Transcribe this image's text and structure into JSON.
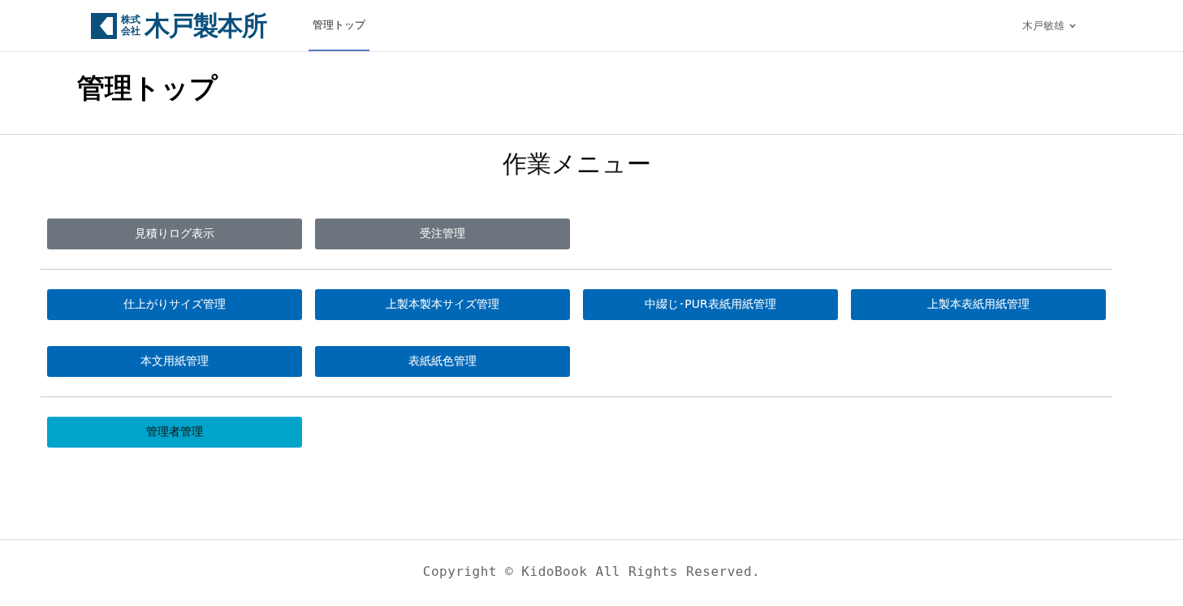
{
  "header": {
    "logo": {
      "small": "株式会社",
      "name": "木戸製本所"
    },
    "nav": [
      {
        "label": "管理トップ",
        "selected": true
      }
    ],
    "user": {
      "name": "木戸敏雄"
    }
  },
  "page_title": "管理トップ",
  "menu": {
    "title": "作業メニュー",
    "groups": [
      {
        "buttons": [
          {
            "label": "見積りログ表示",
            "kind": "secondary"
          },
          {
            "label": "受注管理",
            "kind": "secondary"
          }
        ]
      },
      {
        "buttons": [
          {
            "label": "仕上がりサイズ管理",
            "kind": "primary"
          },
          {
            "label": "上製本製本サイズ管理",
            "kind": "primary"
          },
          {
            "label": "中綴じ･PUR表紙用紙管理",
            "kind": "primary"
          },
          {
            "label": "上製本表紙用紙管理",
            "kind": "primary"
          },
          {
            "label": "本文用紙管理",
            "kind": "primary"
          },
          {
            "label": "表紙紙色管理",
            "kind": "primary"
          }
        ]
      },
      {
        "buttons": [
          {
            "label": "管理者管理",
            "kind": "info"
          }
        ]
      }
    ]
  },
  "footer": {
    "copyright": "Copyright © KidoBook All Rights Reserved."
  }
}
